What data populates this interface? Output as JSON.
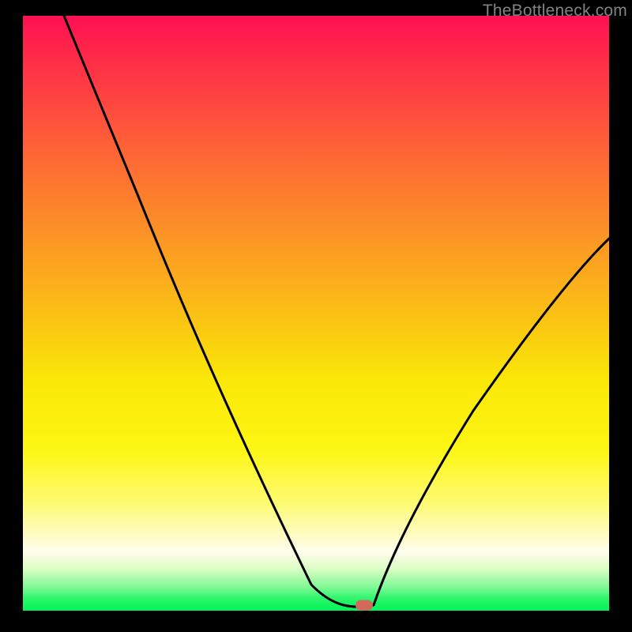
{
  "watermark": "TheBottleneck.com",
  "chart_data": {
    "type": "line",
    "title": "",
    "xlabel": "",
    "ylabel": "",
    "xlim": [
      0,
      100
    ],
    "ylim": [
      0,
      100
    ],
    "grid": false,
    "legend": false,
    "background_gradient_stops": [
      {
        "pos": 0,
        "color": "#ff1054"
      },
      {
        "pos": 6,
        "color": "#ff2749"
      },
      {
        "pos": 16,
        "color": "#fe4c3e"
      },
      {
        "pos": 27,
        "color": "#fd7330"
      },
      {
        "pos": 38,
        "color": "#fc9724"
      },
      {
        "pos": 50,
        "color": "#fbc015"
      },
      {
        "pos": 61,
        "color": "#fae707"
      },
      {
        "pos": 73,
        "color": "#fdf614"
      },
      {
        "pos": 82,
        "color": "#fefb74"
      },
      {
        "pos": 90,
        "color": "#fffded"
      },
      {
        "pos": 93,
        "color": "#dbfdc4"
      },
      {
        "pos": 96,
        "color": "#81f995"
      },
      {
        "pos": 98,
        "color": "#2bf66a"
      },
      {
        "pos": 100,
        "color": "#00f458"
      }
    ],
    "series": [
      {
        "name": "bottleneck-curve",
        "x": [
          7,
          20,
          27,
          40,
          49,
          55,
          58,
          60,
          63,
          70,
          80,
          90,
          100
        ],
        "y": [
          100,
          70,
          55,
          30,
          4,
          0,
          0,
          1,
          11,
          33,
          52,
          60,
          63
        ]
      }
    ],
    "marker": {
      "x": 58,
      "y": 0,
      "color": "#d3685d"
    }
  }
}
